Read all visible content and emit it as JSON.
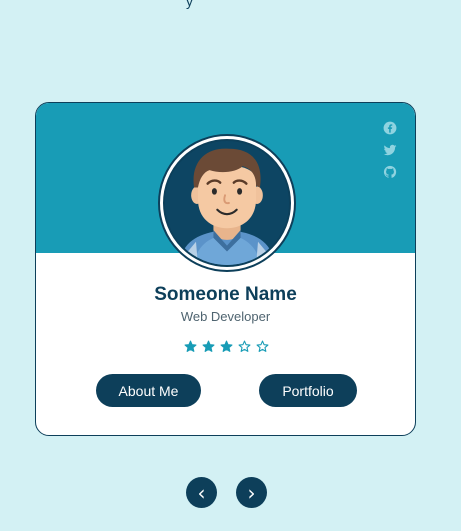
{
  "page": {
    "top_partial_glyph": "y"
  },
  "card": {
    "name": "Someone Name",
    "role": "Web Developer",
    "rating": 3,
    "rating_max": 5,
    "social": [
      {
        "icon": "facebook-icon"
      },
      {
        "icon": "twitter-icon"
      },
      {
        "icon": "github-icon"
      }
    ],
    "buttons": {
      "about": "About Me",
      "portfolio": "Portfolio"
    },
    "colors": {
      "header": "#189cb6",
      "primary": "#0d3f5a",
      "background": "#d3f1f4"
    }
  },
  "nav": {
    "prev": "‹",
    "next": "›"
  }
}
